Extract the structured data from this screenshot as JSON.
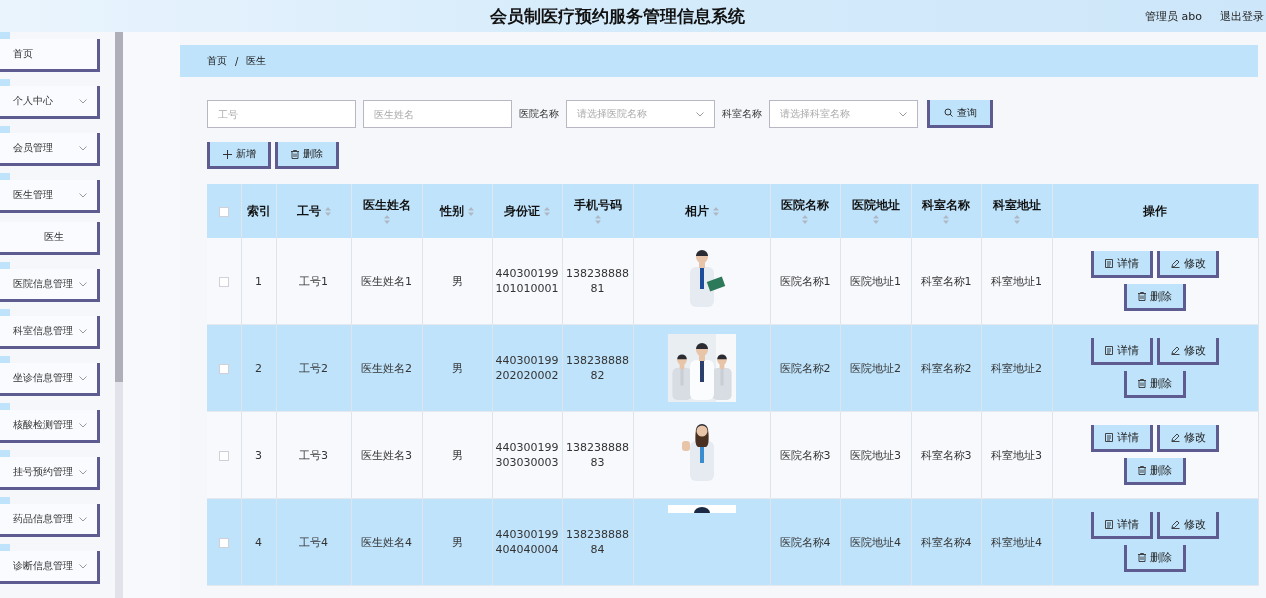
{
  "header": {
    "title": "会员制医疗预约服务管理信息系统",
    "user": "管理员 abo",
    "logout": "退出登录"
  },
  "sidebar": {
    "items": [
      {
        "label": "首页",
        "has_arrow": false
      },
      {
        "label": "个人中心",
        "has_arrow": true
      },
      {
        "label": "会员管理",
        "has_arrow": true
      },
      {
        "label": "医生管理",
        "has_arrow": true,
        "children": [
          {
            "label": "医生",
            "has_arrow": false
          }
        ]
      },
      {
        "label": "医院信息管理",
        "has_arrow": true
      },
      {
        "label": "科室信息管理",
        "has_arrow": true
      },
      {
        "label": "坐诊信息管理",
        "has_arrow": true
      },
      {
        "label": "核酸检测管理",
        "has_arrow": true
      },
      {
        "label": "挂号预约管理",
        "has_arrow": true
      },
      {
        "label": "药品信息管理",
        "has_arrow": true
      },
      {
        "label": "诊断信息管理",
        "has_arrow": true
      }
    ]
  },
  "breadcrumb": [
    "首页",
    "医生"
  ],
  "breadcrumb_separator": "/",
  "search": {
    "fields": [
      {
        "kind": "input",
        "placeholder": "工号"
      },
      {
        "kind": "input",
        "placeholder": "医生姓名"
      },
      {
        "kind": "select",
        "label": "医院名称",
        "placeholder": "请选择医院名称"
      },
      {
        "kind": "select",
        "label": "科室名称",
        "placeholder": "请选择科室名称"
      }
    ],
    "button": "查询"
  },
  "actions": [
    {
      "kind": "add",
      "label": "新增"
    },
    {
      "kind": "delete",
      "label": "删除"
    }
  ],
  "table": {
    "header_checked": false,
    "columns": [
      {
        "label": "索引",
        "sortable": false
      },
      {
        "label": "工号",
        "sortable": true
      },
      {
        "label": "医生姓名",
        "sortable": true
      },
      {
        "label": "性别",
        "sortable": true
      },
      {
        "label": "身份证",
        "sortable": true
      },
      {
        "label": "手机号码",
        "sortable": true
      },
      {
        "label": "相片",
        "sortable": true
      },
      {
        "label": "医院名称",
        "sortable": true
      },
      {
        "label": "医院地址",
        "sortable": true
      },
      {
        "label": "科室名称",
        "sortable": true
      },
      {
        "label": "科室地址",
        "sortable": true
      },
      {
        "label": "操作",
        "sortable": false
      }
    ],
    "rows": [
      {
        "checked": false,
        "cells": [
          "1",
          "工号1",
          "医生姓名1",
          "男",
          "440300199101010001",
          "13823888881",
          {
            "kind": "single"
          },
          "医院名称1",
          "医院地址1",
          "科室名称1",
          "科室地址1",
          {
            "kind": "actions",
            "buttons": [
              {
                "kind": "detail",
                "label": "详情"
              },
              {
                "kind": "edit",
                "label": "修改"
              },
              {
                "kind": "delete",
                "label": "删除"
              }
            ]
          }
        ]
      },
      {
        "checked": false,
        "cells": [
          "2",
          "工号2",
          "医生姓名2",
          "男",
          "440300199202020002",
          "13823888882",
          {
            "kind": "group"
          },
          "医院名称2",
          "医院地址2",
          "科室名称2",
          "科室地址2",
          {
            "kind": "actions",
            "buttons": [
              {
                "kind": "detail",
                "label": "详情"
              },
              {
                "kind": "edit",
                "label": "修改"
              },
              {
                "kind": "delete",
                "label": "删除"
              }
            ]
          }
        ]
      },
      {
        "checked": false,
        "cells": [
          "3",
          "工号3",
          "医生姓名3",
          "男",
          "440300199303030003",
          "13823888883",
          {
            "kind": "woman"
          },
          "医院名称3",
          "医院地址3",
          "科室名称3",
          "科室地址3",
          {
            "kind": "actions",
            "buttons": [
              {
                "kind": "detail",
                "label": "详情"
              },
              {
                "kind": "edit",
                "label": "修改"
              },
              {
                "kind": "delete",
                "label": "删除"
              }
            ]
          }
        ]
      },
      {
        "checked": false,
        "cells": [
          "4",
          "工号4",
          "医生姓名4",
          "男",
          "440300199404040004",
          "13823888884",
          {
            "kind": "partial"
          },
          "医院名称4",
          "医院地址4",
          "科室名称4",
          "科室地址4",
          {
            "kind": "actions",
            "buttons": [
              {
                "kind": "detail",
                "label": "详情"
              },
              {
                "kind": "edit",
                "label": "修改"
              },
              {
                "kind": "delete",
                "label": "删除"
              }
            ]
          }
        ]
      }
    ]
  }
}
